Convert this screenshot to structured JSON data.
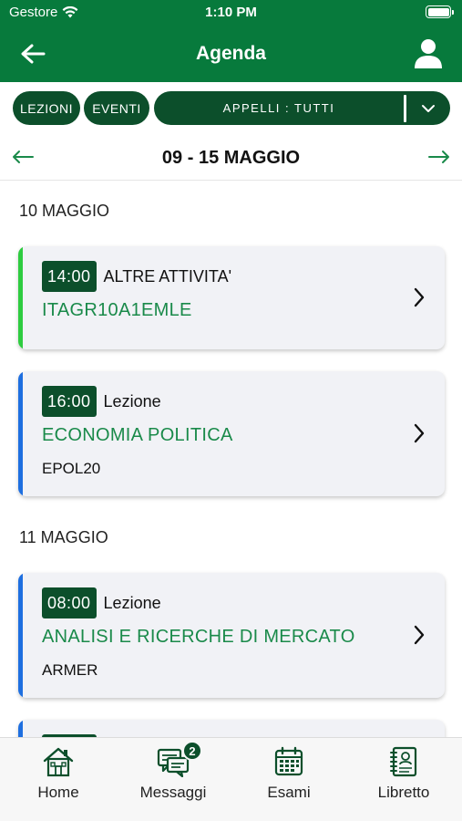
{
  "status": {
    "carrier": "Gestore",
    "time": "1:10 PM"
  },
  "nav": {
    "title": "Agenda"
  },
  "filters": {
    "lezioni": "LEZIONI",
    "eventi": "EVENTI",
    "appelli": "APPELLI : TUTTI"
  },
  "week": {
    "range": "09 - 15 MAGGIO"
  },
  "days": [
    {
      "date": "10 MAGGIO",
      "items": [
        {
          "time": "14:00",
          "type": "ALTRE ATTIVITA'",
          "course": "ITAGR10A1EMLE",
          "code": "",
          "accent": "#2ecc40"
        },
        {
          "time": "16:00",
          "type": "Lezione",
          "course": "ECONOMIA POLITICA",
          "code": "EPOL20",
          "accent": "#1e6fe0"
        }
      ]
    },
    {
      "date": "11 MAGGIO",
      "items": [
        {
          "time": "08:00",
          "type": "Lezione",
          "course": "ANALISI E RICERCHE DI MERCATO",
          "code": "ARMER",
          "accent": "#1e6fe0"
        }
      ]
    }
  ],
  "tabs": [
    {
      "label": "Home",
      "icon": "home-icon"
    },
    {
      "label": "Messaggi",
      "icon": "messages-icon",
      "badge": "2"
    },
    {
      "label": "Esami",
      "icon": "calendar-icon"
    },
    {
      "label": "Libretto",
      "icon": "booklet-icon"
    }
  ],
  "colors": {
    "primary": "#077a3c",
    "dark_green": "#0c4f2b",
    "course_text": "#1a8a4a"
  }
}
